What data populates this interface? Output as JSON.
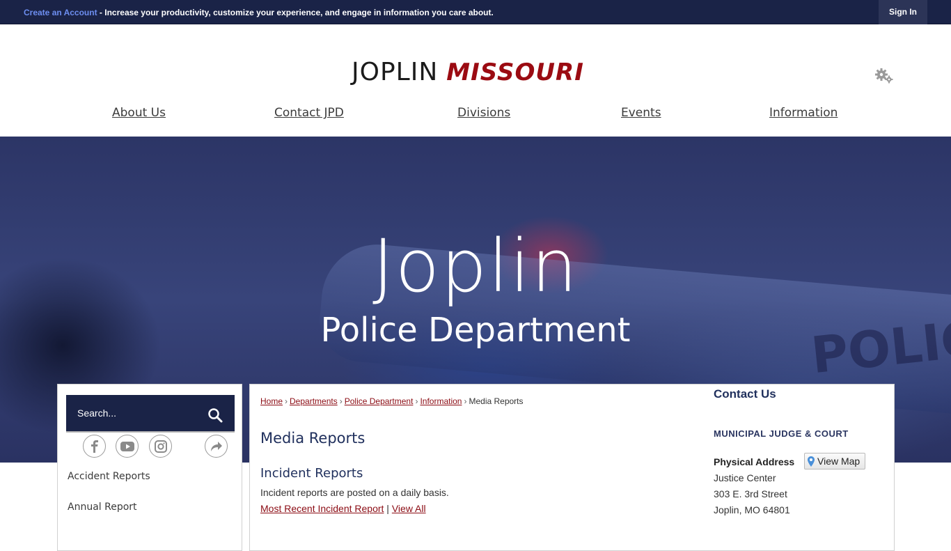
{
  "topbar": {
    "create_account": "Create an Account",
    "message": " - Increase your productivity, customize your experience, and engage in information you care about.",
    "sign_in": "Sign In"
  },
  "logo": {
    "city": "JOPLIN",
    "state": "MISSOURI"
  },
  "nav": {
    "items": [
      {
        "label": "About Us"
      },
      {
        "label": "Contact JPD"
      },
      {
        "label": "Divisions"
      },
      {
        "label": "Events"
      },
      {
        "label": "Information"
      }
    ]
  },
  "hero": {
    "title": "Joplin",
    "subtitle": "Police Department",
    "background_text": "POLIC"
  },
  "sidebar": {
    "search_placeholder": "Search...",
    "social": [
      "facebook-icon",
      "youtube-icon",
      "instagram-icon",
      "share-icon"
    ],
    "links": [
      {
        "label": "Accident Reports"
      },
      {
        "label": "Annual Report"
      }
    ]
  },
  "breadcrumb": {
    "items": [
      "Home",
      "Departments",
      "Police Department",
      "Information"
    ],
    "current": "Media Reports"
  },
  "content": {
    "title": "Media Reports",
    "section_title": "Incident Reports",
    "description": "Incident reports are posted on a daily basis.",
    "link_recent": "Most Recent Incident Report",
    "separator": " | ",
    "link_all": "View All"
  },
  "contact": {
    "title": "Contact Us",
    "org": "MUNICIPAL JUDGE & COURT",
    "address_label": "Physical Address",
    "view_map": "View Map",
    "address_lines": [
      "Justice Center",
      "303 E. 3rd Street",
      "Joplin, MO 64801"
    ]
  },
  "colors": {
    "navy": "#1a2347",
    "brand_red": "#9b0b12",
    "link_red": "#8b0b13",
    "heading_blue": "#1f2f5c"
  }
}
